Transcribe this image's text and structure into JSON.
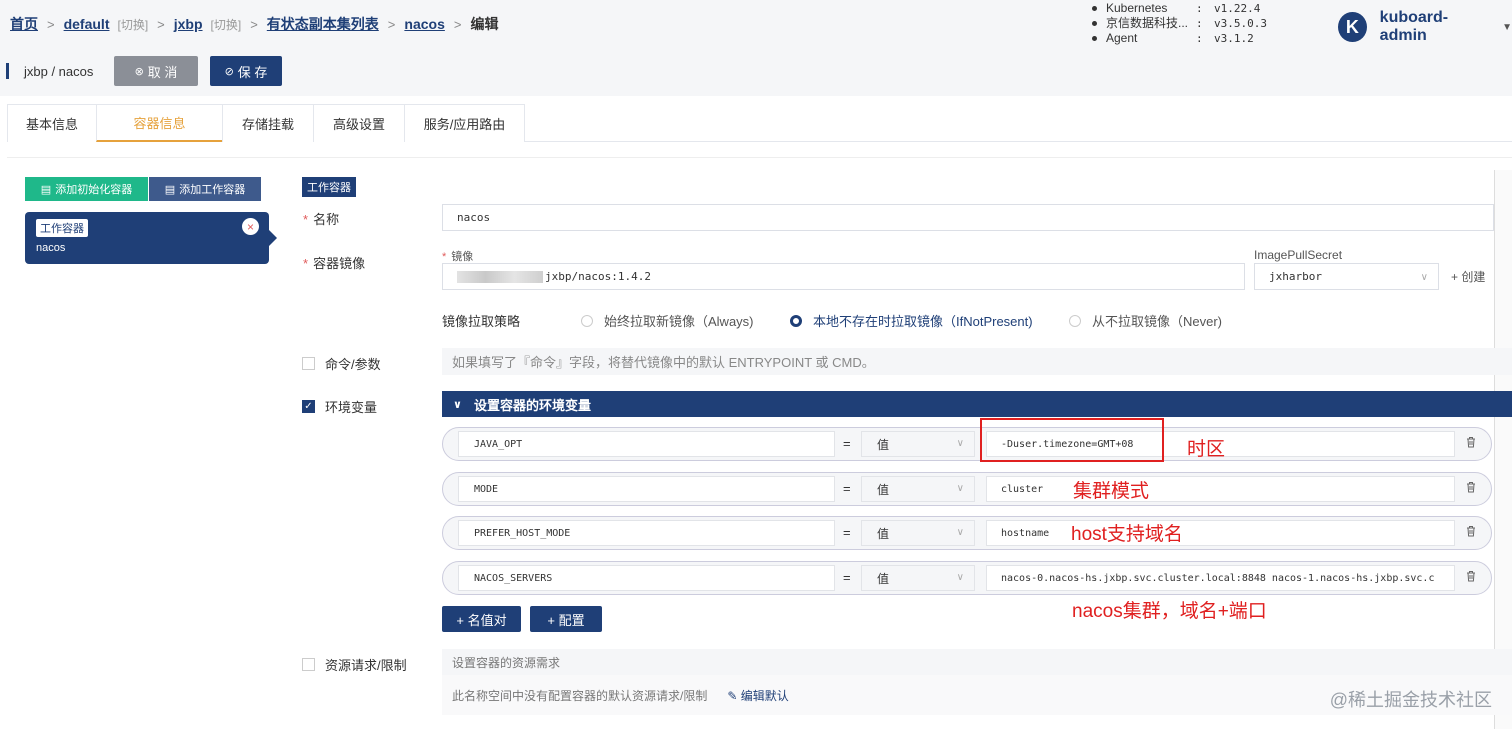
{
  "breadcrumb": [
    {
      "label": "首页",
      "switch": ""
    },
    {
      "label": "default",
      "switch": "[切换]"
    },
    {
      "label": "jxbp",
      "switch": "[切换]"
    },
    {
      "label": "有状态副本集列表",
      "switch": ""
    },
    {
      "label": "nacos",
      "switch": ""
    }
  ],
  "breadcrumb_current": "编辑",
  "versions": [
    {
      "name": "Kubernetes",
      "colon": ":",
      "value": "v1.22.4"
    },
    {
      "name": "京信数据科技...",
      "colon": ":",
      "value": "v3.5.0.3"
    },
    {
      "name": "Agent",
      "colon": ":",
      "value": "v3.1.2"
    }
  ],
  "user": {
    "avatar_letter": "K",
    "name": "kuboard-admin"
  },
  "page_title": "jxbp / nacos",
  "buttons": {
    "cancel": "取 消",
    "save": "保 存"
  },
  "tabs": [
    "基本信息",
    "容器信息",
    "存储挂载",
    "高级设置",
    "服务/应用路由"
  ],
  "active_tab": "容器信息",
  "add_buttons": {
    "init": "添加初始化容器",
    "work": "添加工作容器"
  },
  "container_card": {
    "tag": "工作容器",
    "name": "nacos"
  },
  "form": {
    "section_tag": "工作容器",
    "name_label": "名称",
    "name_value": "nacos",
    "image_label": "容器镜像",
    "image_sublabel": "镜像",
    "image_value": "jxbp/nacos:1.4.2",
    "pull_secret_label": "ImagePullSecret",
    "pull_secret_value": "jxharbor",
    "create_link": "+ 创建",
    "pull_policy_label": "镜像拉取策略",
    "pull_policies": [
      {
        "label": "始终拉取新镜像（Always)",
        "selected": false
      },
      {
        "label": "本地不存在时拉取镜像（IfNotPresent)",
        "selected": true
      },
      {
        "label": "从不拉取镜像（Never)",
        "selected": false
      }
    ],
    "command_label": "命令/参数",
    "command_hint": "如果填写了『命令』字段，将替代镜像中的默认 ENTRYPOINT 或 CMD。",
    "env_label": "环境变量",
    "env_header": "设置容器的环境变量",
    "env_vars": [
      {
        "name": "JAVA_OPT",
        "eq": "=",
        "type": "值",
        "value": "-Duser.timezone=GMT+08"
      },
      {
        "name": "MODE",
        "eq": "=",
        "type": "值",
        "value": "cluster"
      },
      {
        "name": "PREFER_HOST_MODE",
        "eq": "=",
        "type": "值",
        "value": "hostname"
      },
      {
        "name": "NACOS_SERVERS",
        "eq": "=",
        "type": "值",
        "value": "nacos-0.nacos-hs.jxbp.svc.cluster.local:8848 nacos-1.nacos-hs.jxbp.svc.c"
      }
    ],
    "add_kv": "+ 名值对",
    "add_config": "+ 配置",
    "resource_label": "资源请求/限制",
    "resource_title": "设置容器的资源需求",
    "resource_body": "此名称空间中没有配置容器的默认资源请求/限制",
    "resource_edit": "编辑默认"
  },
  "annotations": {
    "timezone": "时区",
    "cluster_mode": "集群模式",
    "host_domain": "host支持域名",
    "nacos_cluster": "nacos集群，域名+端口"
  },
  "watermark": "@稀土掘金技术社区",
  "colors": {
    "primary": "#1f3f77",
    "accent": "#e6a23c",
    "green": "#1fb88a",
    "annotation": "#e02020"
  }
}
